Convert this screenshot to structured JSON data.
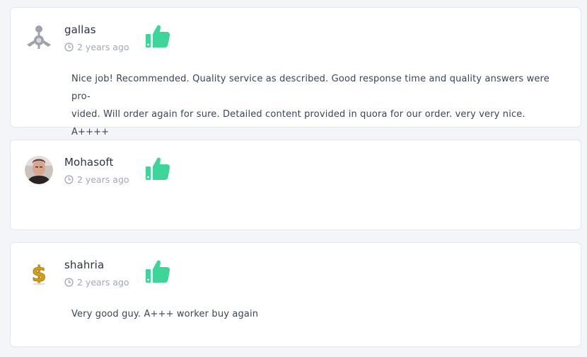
{
  "reviews": [
    {
      "username": "gallas",
      "time_ago": "2 years ago",
      "rating_icon": "thumbs-up-icon",
      "avatar_icon": "default-user-avatar-icon",
      "text_line1": "Nice job! Recommended. Quality service as described. Good response time and quality answers were pro-",
      "text_line2": "vided. Will order again for sure. Detailed content provided in quora for our order. very very nice. A++++"
    },
    {
      "username": "Mohasoft",
      "time_ago": "2 years ago",
      "rating_icon": "thumbs-up-icon",
      "avatar_icon": "user-photo-avatar"
    },
    {
      "username": "shahria",
      "time_ago": "2 years ago",
      "rating_icon": "thumbs-up-icon",
      "avatar_icon": "gold-dollar-sign-avatar",
      "text_line1": "Very good guy. A+++ worker buy again"
    }
  ],
  "colors": {
    "thumb": "#3dd598",
    "muted": "#a1a8b6",
    "card_border": "#e3e6ee",
    "page_bg": "#f4f5f9"
  }
}
